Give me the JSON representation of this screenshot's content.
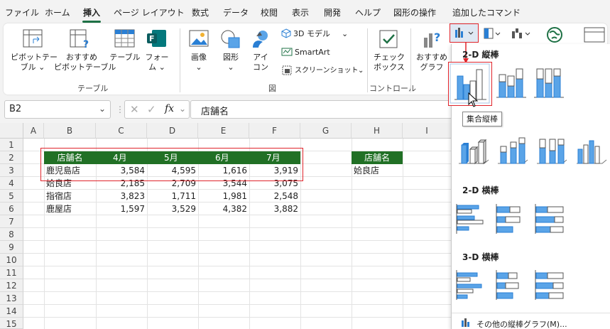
{
  "menu": {
    "tabs": [
      "ファイル",
      "ホーム",
      "挿入",
      "ページ レイアウト",
      "数式",
      "データ",
      "校閲",
      "表示",
      "開発",
      "ヘルプ",
      "図形の操作",
      "追加したコマンド"
    ],
    "active": "挿入"
  },
  "ribbon": {
    "pivot_table": "ピボットテー\nブル ⌄",
    "recommended_pivot": "おすすめ\nピボットテーブル",
    "table": "テーブル",
    "form": "フォー\nム ⌄",
    "group_table": "テーブル",
    "image": "画像\n⌄",
    "shapes": "図形\n⌄",
    "icons": "アイ\nコン",
    "model_3d": "3D モデル",
    "smartart": "SmartArt",
    "screenshot": "スクリーンショット",
    "group_illust": "図",
    "checkbox": "チェック\nボックス",
    "group_control": "コントロール",
    "recommended_chart": "おすすめ\nグラフ"
  },
  "formula_bar": {
    "name_box": "B2",
    "fx": "fx",
    "content": "店舗名"
  },
  "sheet": {
    "columns": [
      "A",
      "B",
      "C",
      "D",
      "E",
      "F",
      "G",
      "H",
      "I"
    ],
    "rows": [
      "1",
      "2",
      "3",
      "4",
      "5",
      "6",
      "7",
      "8",
      "9",
      "10",
      "11",
      "12",
      "13",
      "14",
      "15"
    ],
    "table_header": [
      "店舗名",
      "4月",
      "5月",
      "6月",
      "7月"
    ],
    "table_rows": [
      [
        "鹿児島店",
        "3,584",
        "4,595",
        "1,616",
        "3,919"
      ],
      [
        "姶良店",
        "2,185",
        "2,709",
        "3,544",
        "3,075"
      ],
      [
        "指宿店",
        "3,823",
        "1,711",
        "1,981",
        "2,548"
      ],
      [
        "鹿屋店",
        "1,597",
        "3,529",
        "4,382",
        "3,882"
      ]
    ],
    "h2": "店舗名",
    "h3": "姶良店"
  },
  "dropdown": {
    "sec_2d_column": "2-D 縦棒",
    "sec_3d_column": "",
    "sec_2d_bar": "2-D 横棒",
    "sec_3d_bar": "3-D 横棒",
    "more": "その他の縦棒グラフ(M)...",
    "tooltip": "集合縦棒"
  },
  "colors": {
    "accent": "#1e7145",
    "header_fill": "#217025",
    "highlight": "#e0242b",
    "chart_blue": "#5aa4e8"
  }
}
